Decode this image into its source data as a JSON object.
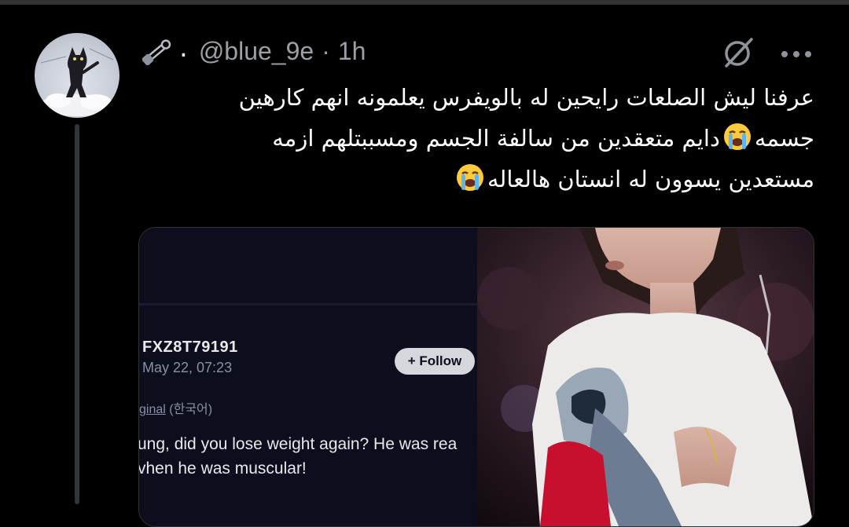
{
  "tweet": {
    "display_name": ".",
    "handle": "@blue_9e",
    "separator": "·",
    "time": "1h",
    "lines": [
      "عرفنا ليش الصلعات رايحين له بالويفرس يعلمونه انهم كارهين",
      "جسمه",
      "دايم متعقدين من سالفة الجسم ومسببتلهم ازمه",
      "مستعدين يسوون له انستان هالعاله"
    ]
  },
  "media": {
    "screenshot": {
      "user_id": "FXZ8T79191",
      "date": "May 22, 07:23",
      "follow_label": "+ Follow",
      "original_link": "ginal",
      "original_lang": "(한국어)",
      "translated_lines": [
        "ung, did you lose weight again? He was rea",
        "vhen he was muscular!"
      ]
    }
  },
  "icons": {
    "pin": "safety-pin-icon",
    "grok": "grok-icon",
    "more": "more-horizontal-icon",
    "emoji": "loudly-crying-face-emoji"
  },
  "colors": {
    "background": "#000000",
    "text": "#ffffff",
    "muted": "#9aa0a6",
    "border": "#2f3336"
  }
}
